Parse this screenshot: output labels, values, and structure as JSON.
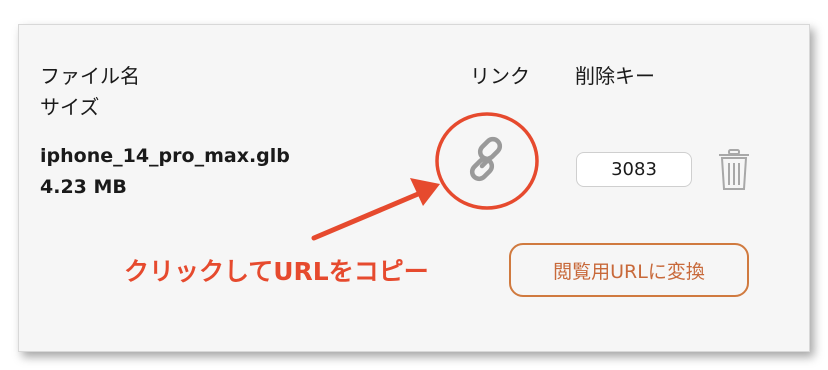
{
  "table": {
    "header_filename": "ファイル名",
    "header_size": "サイズ",
    "header_link": "リンク",
    "header_delete_key": "削除キー"
  },
  "file": {
    "name": "iphone_14_pro_max.glb",
    "size": "4.23 MB",
    "delete_key": "3083"
  },
  "icons": {
    "link": "link-icon",
    "delete": "trash-icon"
  },
  "convert_button_label": "閲覧用URLに変換",
  "annotation_text": "クリックしてURLをコピー",
  "colors": {
    "annotation": "#e64a2e",
    "convert_button": "#d07a3f",
    "link_icon": "#9a9a9a"
  }
}
